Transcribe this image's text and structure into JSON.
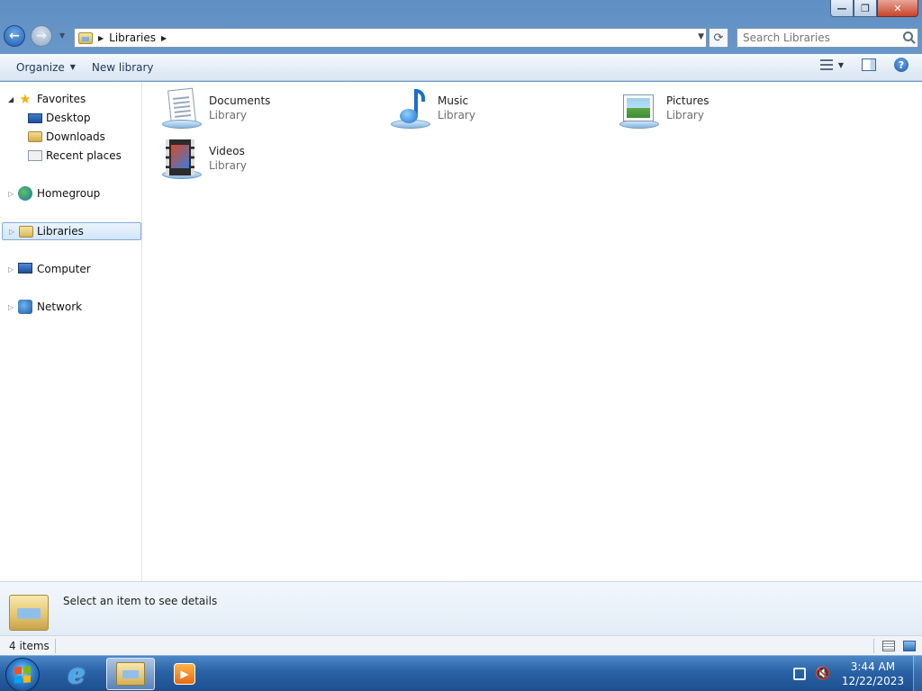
{
  "window": {
    "caption_buttons": {
      "minimize": "—",
      "maximize": "❐",
      "close": "✕"
    }
  },
  "nav": {
    "back_glyph": "←",
    "forward_glyph": "→",
    "recent_glyph": "▼"
  },
  "address": {
    "segments": [
      "Libraries"
    ],
    "separator": "▶",
    "dropdown_glyph": "▼",
    "refresh_glyph": "⟳"
  },
  "search": {
    "placeholder": "Search Libraries",
    "value": ""
  },
  "toolbar": {
    "organize_label": "Organize",
    "organize_caret": "▼",
    "new_library_label": "New library",
    "views_caret": "▼",
    "help_glyph": "?"
  },
  "navpane": {
    "favorites_label": "Favorites",
    "desktop_label": "Desktop",
    "downloads_label": "Downloads",
    "recent_label": "Recent places",
    "homegroup_label": "Homegroup",
    "libraries_label": "Libraries",
    "computer_label": "Computer",
    "network_label": "Network",
    "expanded_glyph": "◢",
    "collapsed_glyph": "▷"
  },
  "libraries": [
    {
      "name": "Documents",
      "type": "Library",
      "icon": "documents-icon"
    },
    {
      "name": "Music",
      "type": "Library",
      "icon": "music-icon"
    },
    {
      "name": "Pictures",
      "type": "Library",
      "icon": "pictures-icon"
    },
    {
      "name": "Videos",
      "type": "Library",
      "icon": "videos-icon"
    }
  ],
  "details": {
    "text": "Select an item to see details"
  },
  "status": {
    "count": "4 items"
  },
  "taskbar": {
    "ie_glyph": "e",
    "media_glyph": "▶",
    "volume_glyph": "🔇",
    "time": "3:44 AM",
    "date": "12/22/2023",
    "flag_colors": [
      "#f25022",
      "#7fba00",
      "#00a4ef",
      "#ffb900"
    ]
  },
  "colors": {
    "selection_border": "#84acdd",
    "link_text": "#1e395b",
    "secondary_text": "#6d6d6d"
  }
}
